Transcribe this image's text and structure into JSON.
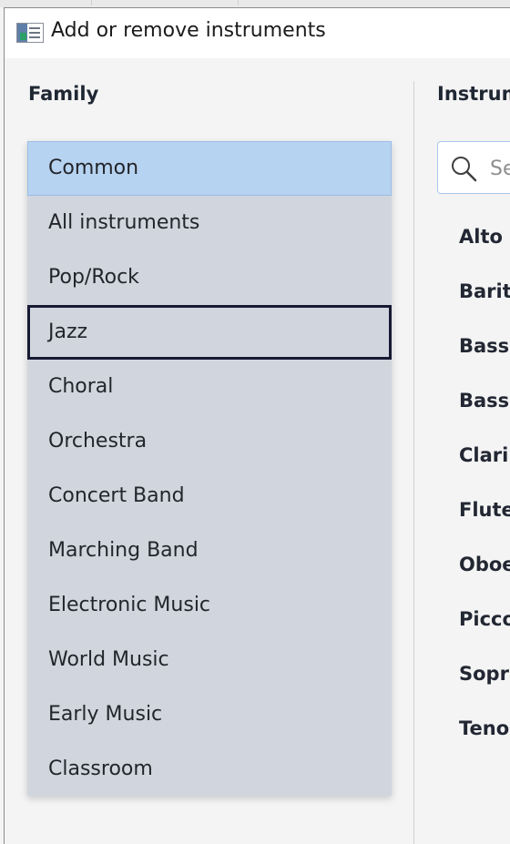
{
  "window": {
    "title": "Add or remove instruments",
    "icon": "app-icon"
  },
  "family": {
    "heading": "Family",
    "items": [
      "Common",
      "All instruments",
      "Pop/Rock",
      "Jazz",
      "Choral",
      "Orchestra",
      "Concert Band",
      "Marching Band",
      "Electronic Music",
      "World Music",
      "Early Music",
      "Classroom"
    ],
    "selected": "Common",
    "focused": "Jazz"
  },
  "instruments": {
    "heading": "Instrum",
    "search": {
      "placeholder": "Se",
      "icon": "search-icon"
    },
    "items": [
      "Alto S",
      "Barito",
      "Bass C",
      "Basso",
      "Clarin",
      "Flute",
      "Oboe",
      "Picco",
      "Sopra",
      "Tenor"
    ]
  },
  "colors": {
    "selected_background": "#b6d3f1",
    "list_background": "#d1d6de",
    "focus_border": "#161a33",
    "window_background": "#f4f4f4"
  }
}
